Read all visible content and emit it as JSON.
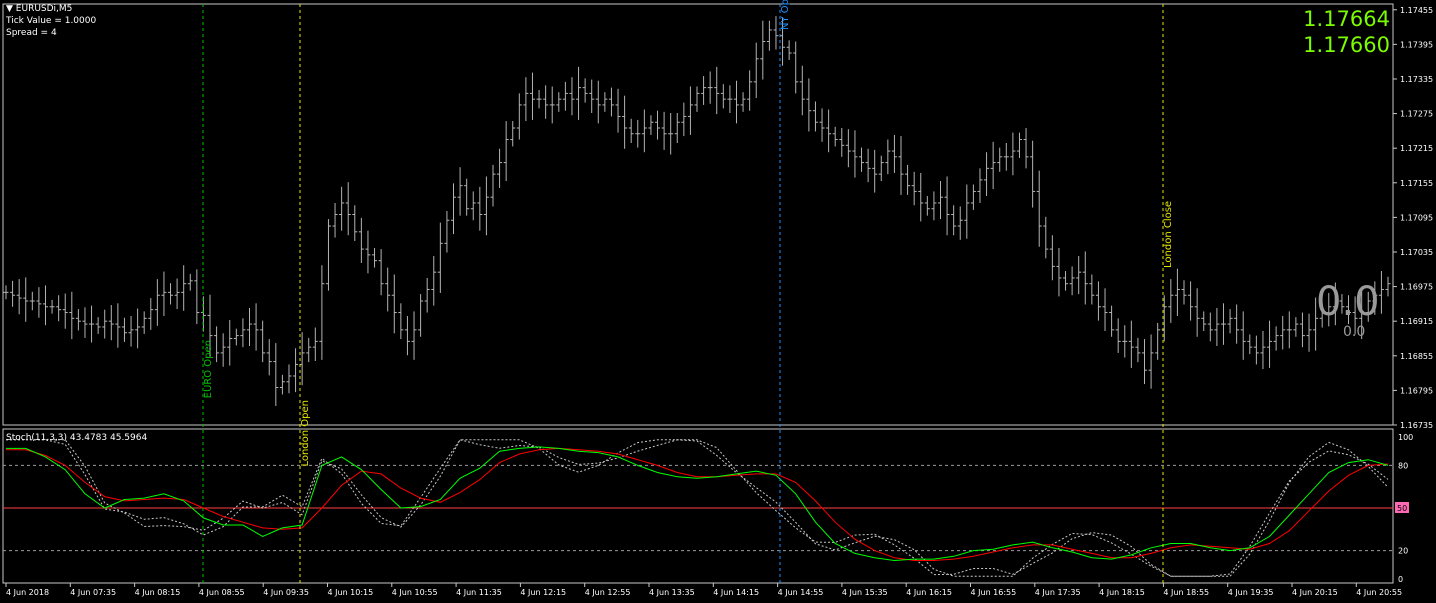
{
  "header": {
    "symbol_label": "EURUSDi,M5",
    "tick_value": "Tick Value = 1.0000",
    "spread": "Spread = 4"
  },
  "quotes": {
    "ask": "1.17664",
    "bid": "1.17660"
  },
  "counter": {
    "big": "0.0",
    "small": "0.0"
  },
  "session_labels": [
    {
      "id": "euro",
      "text": "EURO Open",
      "color": "#00c000",
      "time": "4 Jun 08:25"
    },
    {
      "id": "london-open",
      "text": "London Open",
      "color": "#e6e600",
      "time": "4 Jun 09:10"
    },
    {
      "id": "ny-open",
      "text": "NY Open",
      "color": "#1e90ff",
      "time": "4 Jun 14:30"
    },
    {
      "id": "london-close",
      "text": "London Close",
      "color": "#e6e600",
      "time": "4 Jun 18:40"
    }
  ],
  "stoch_label": "Stoch(11,3,3) 43.4783 45.5964",
  "price_axis": [
    "1.17455",
    "1.17395",
    "1.17335",
    "1.17275",
    "1.17215",
    "1.17155",
    "1.17095",
    "1.17035",
    "1.16975",
    "1.16915",
    "1.16855",
    "1.16795",
    "1.16735"
  ],
  "stoch_axis": [
    "100",
    "80",
    "50",
    "20",
    "0"
  ],
  "time_axis": [
    "4 Jun 2018",
    "4 Jun 07:35",
    "4 Jun 08:15",
    "4 Jun 08:55",
    "4 Jun 09:35",
    "4 Jun 10:15",
    "4 Jun 10:55",
    "4 Jun 11:35",
    "4 Jun 12:15",
    "4 Jun 12:55",
    "4 Jun 13:35",
    "4 Jun 14:15",
    "4 Jun 14:55",
    "4 Jun 15:35",
    "4 Jun 16:15",
    "4 Jun 16:55",
    "4 Jun 17:35",
    "4 Jun 18:15",
    "4 Jun 18:55",
    "4 Jun 19:35",
    "4 Jun 20:15",
    "4 Jun 20:55"
  ],
  "colors": {
    "bars": "#b4b4b4",
    "stoch_main": "#00ff00",
    "stoch_signal": "#ff0000",
    "stoch_level50": "#ff4040",
    "level50_tag_bg": "#ff69b4",
    "quote": "#7cfc00"
  },
  "chart_data": [
    {
      "type": "ohlc",
      "symbol": "EURUSDi",
      "timeframe": "M5",
      "ylim": [
        1.16735,
        1.17465
      ],
      "close_series": [
        1.16965,
        1.1696,
        1.16955,
        1.1695,
        1.1695,
        1.16945,
        1.1694,
        1.1694,
        1.16935,
        1.1693,
        1.1692,
        1.16915,
        1.1691,
        1.1691,
        1.16905,
        1.16915,
        1.1691,
        1.16905,
        1.16895,
        1.169,
        1.16905,
        1.1692,
        1.16935,
        1.1696,
        1.16965,
        1.1696,
        1.16965,
        1.1698,
        1.16985,
        1.1693,
        1.16925,
        1.1689,
        1.1686,
        1.1687,
        1.16885,
        1.1689,
        1.169,
        1.1691,
        1.169,
        1.1686,
        1.16845,
        1.168,
        1.1681,
        1.1682,
        1.1684,
        1.1686,
        1.1687,
        1.1688,
        1.1698,
        1.1708,
        1.171,
        1.1712,
        1.171,
        1.1707,
        1.1704,
        1.1703,
        1.1702,
        1.1698,
        1.1696,
        1.1693,
        1.169,
        1.1688,
        1.169,
        1.1695,
        1.1697,
        1.17,
        1.1705,
        1.1709,
        1.1713,
        1.1715,
        1.1711,
        1.1712,
        1.171,
        1.1713,
        1.1717,
        1.1719,
        1.1723,
        1.1725,
        1.1729,
        1.1731,
        1.173,
        1.173,
        1.1729,
        1.1729,
        1.173,
        1.1731,
        1.173,
        1.1732,
        1.1731,
        1.173,
        1.1729,
        1.173,
        1.1729,
        1.1727,
        1.1725,
        1.1724,
        1.1724,
        1.1725,
        1.1726,
        1.1725,
        1.1724,
        1.1724,
        1.1726,
        1.1727,
        1.1729,
        1.1731,
        1.1732,
        1.1732,
        1.1731,
        1.173,
        1.173,
        1.1729,
        1.173,
        1.1733,
        1.1737,
        1.174,
        1.1742,
        1.1741,
        1.1739,
        1.1738,
        1.1733,
        1.173,
        1.1728,
        1.1726,
        1.1725,
        1.1724,
        1.1723,
        1.1722,
        1.1721,
        1.172,
        1.1719,
        1.1718,
        1.1717,
        1.1719,
        1.1721,
        1.172,
        1.1717,
        1.1715,
        1.1714,
        1.1712,
        1.1711,
        1.1712,
        1.1713,
        1.171,
        1.1708,
        1.1709,
        1.1712,
        1.1714,
        1.1716,
        1.1718,
        1.1719,
        1.172,
        1.172,
        1.1721,
        1.1723,
        1.172,
        1.1714,
        1.1708,
        1.1704,
        1.1701,
        1.1699,
        1.1698,
        1.1699,
        1.17,
        1.1698,
        1.1696,
        1.1694,
        1.1693,
        1.169,
        1.1688,
        1.1688,
        1.1687,
        1.1686,
        1.1683,
        1.1686,
        1.169,
        1.1694,
        1.1696,
        1.1697,
        1.1696,
        1.1694,
        1.1692,
        1.1691,
        1.169,
        1.1691,
        1.1691,
        1.1692,
        1.169,
        1.1688,
        1.1687,
        1.1686,
        1.1687,
        1.1688,
        1.1689,
        1.169,
        1.169,
        1.1691,
        1.1689,
        1.169,
        1.1692,
        1.1693,
        1.1694,
        1.1695,
        1.1694,
        1.1693,
        1.1692,
        1.1693,
        1.1695,
        1.1696,
        1.1697,
        1.1698
      ]
    },
    {
      "type": "line",
      "title": "Stoch(11,3,3) 43.4783 45.5964",
      "ylim": [
        0,
        100
      ],
      "levels": [
        80,
        50,
        20
      ],
      "series": [
        {
          "name": "main",
          "values": [
            92,
            92,
            86,
            77,
            60,
            50,
            56,
            57,
            60,
            55,
            43,
            38,
            38,
            30,
            36,
            38,
            80,
            86,
            77,
            63,
            50,
            51,
            56,
            71,
            78,
            90,
            92,
            93,
            92,
            90,
            89,
            86,
            80,
            75,
            72,
            71,
            72,
            74,
            76,
            73,
            60,
            40,
            25,
            18,
            15,
            13,
            14,
            14,
            16,
            20,
            21,
            24,
            26,
            22,
            19,
            15,
            14,
            17,
            22,
            25,
            25,
            22,
            20,
            22,
            30,
            45,
            60,
            75,
            82,
            84,
            80
          ]
        },
        {
          "name": "signal",
          "values": [
            91,
            91,
            87,
            80,
            68,
            58,
            55,
            56,
            57,
            56,
            50,
            44,
            40,
            36,
            35,
            36,
            50,
            66,
            76,
            74,
            64,
            57,
            54,
            61,
            70,
            82,
            88,
            91,
            92,
            91,
            90,
            88,
            84,
            80,
            75,
            72,
            72,
            73,
            74,
            74,
            68,
            55,
            40,
            28,
            20,
            15,
            13,
            13,
            14,
            16,
            19,
            22,
            24,
            24,
            21,
            18,
            15,
            15,
            18,
            22,
            24,
            23,
            22,
            21,
            25,
            34,
            48,
            62,
            73,
            80,
            81
          ]
        }
      ]
    }
  ]
}
